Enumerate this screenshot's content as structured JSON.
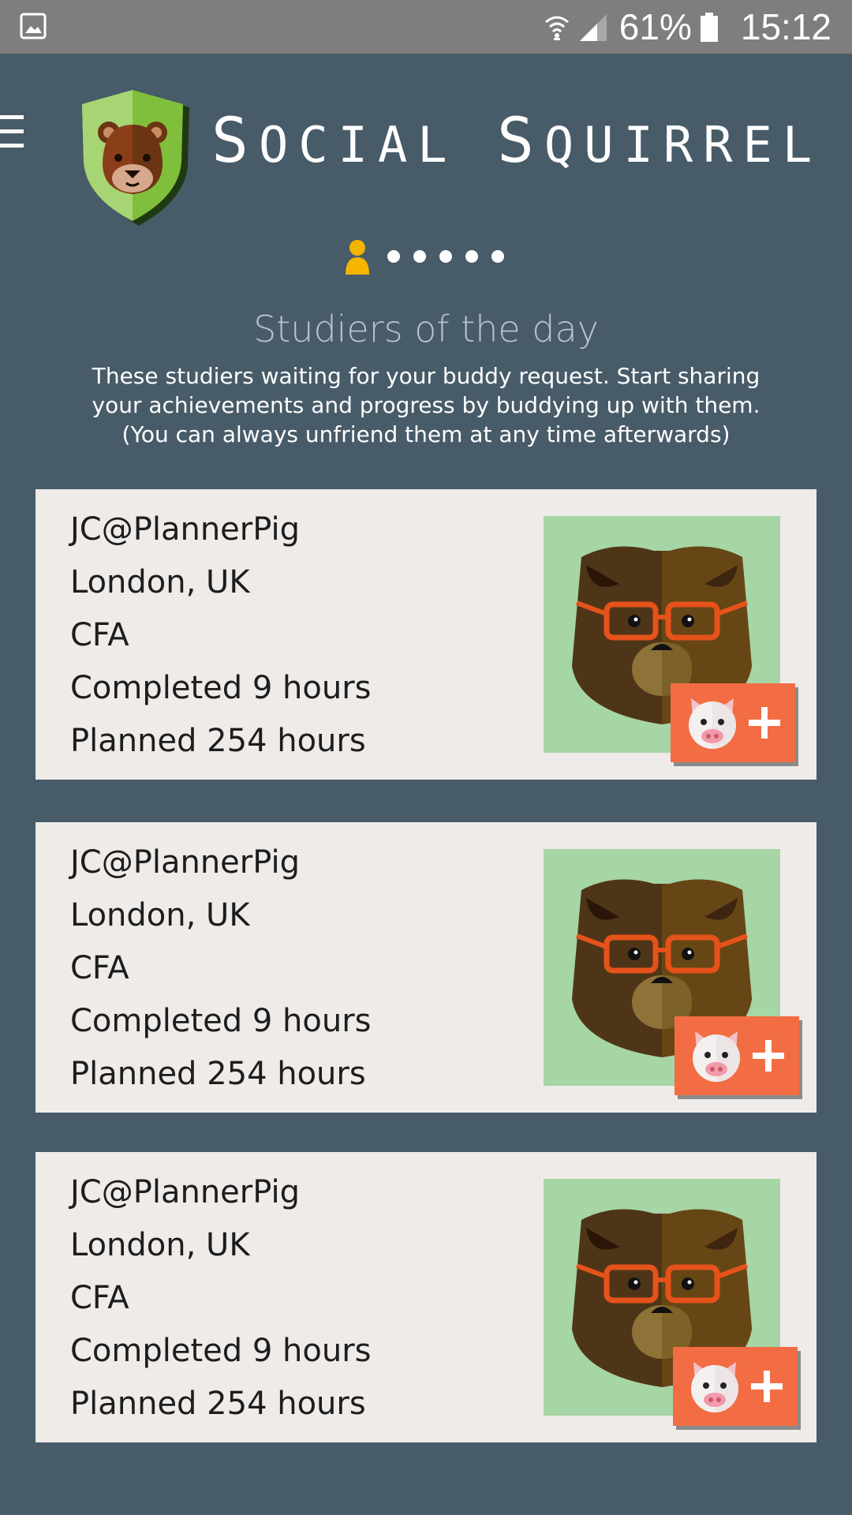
{
  "status_bar": {
    "battery_percent": "61%",
    "time": "15:12",
    "icons": [
      "gallery-icon",
      "wifi-icon",
      "signal-icon",
      "battery-icon"
    ]
  },
  "header": {
    "title_words": [
      {
        "initial": "S",
        "rest": "OCIAL"
      },
      {
        "initial": "S",
        "rest": "QUIRREL"
      }
    ],
    "icons": [
      "menu-icon",
      "squirrel-shield-logo"
    ]
  },
  "pager": {
    "current": 1,
    "total": 6,
    "active_color": "#f5b400"
  },
  "section": {
    "title": "Studiers of the day",
    "description": "These studiers waiting for your buddy request. Start sharing your achievements and progress by buddying up with them. (You can always unfriend them at any time afterwards)"
  },
  "studiers": [
    {
      "username": "JC@PlannerPig",
      "location": "London, UK",
      "course": "CFA",
      "completed": "Completed 9 hours",
      "planned": "Planned 254 hours"
    },
    {
      "username": "JC@PlannerPig",
      "location": "London, UK",
      "course": "CFA",
      "completed": "Completed 9 hours",
      "planned": "Planned 254 hours"
    },
    {
      "username": "JC@PlannerPig",
      "location": "London, UK",
      "course": "CFA",
      "completed": "Completed 9 hours",
      "planned": "Planned 254 hours"
    }
  ],
  "colors": {
    "background": "#485b68",
    "status_bar": "#7e7e7e",
    "card": "#eeebe9",
    "avatar_bg": "#a6d5a6",
    "add_button": "#f26d43"
  }
}
